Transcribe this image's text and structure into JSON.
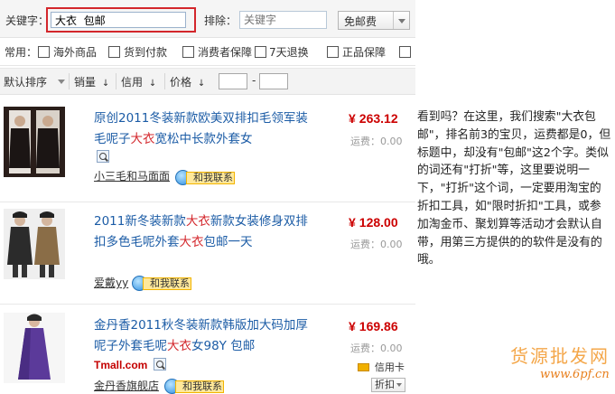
{
  "search": {
    "keyword_label": "关键字：",
    "keyword_value": "大衣  包邮",
    "exclude_label": "排除：",
    "exclude_placeholder": "关键字",
    "shipping_filter": "免邮费"
  },
  "filters": {
    "label": "常用：",
    "options": [
      "海外商品",
      "货到付款",
      "消费者保障",
      "7天退换",
      "正品保障"
    ]
  },
  "sort": {
    "default": "默认排序",
    "sales": "销量",
    "credit": "信用",
    "price": "价格",
    "range_sep": "-"
  },
  "items": [
    {
      "title_parts": [
        "原创2011冬装新款欧美双排扣毛领军装毛呢子",
        "大衣",
        "宽松中长款外套女"
      ],
      "price": "263.12",
      "shipping": "运费：0.00",
      "seller": "小三毛和马面面",
      "contact": "和我联系"
    },
    {
      "title_parts": [
        "2011新冬装新款",
        "大衣",
        "新款女装修身双排扣多色毛呢外套",
        "大衣",
        "包邮一天"
      ],
      "price": "128.00",
      "shipping": "运费：0.00",
      "seller": "爱戴yy",
      "contact": "和我联系"
    },
    {
      "title_parts": [
        "金丹香2011秋冬装新款韩版加大码加厚呢子外套毛呢",
        "大衣",
        "女98Y 包邮"
      ],
      "price": "169.86",
      "shipping": "运费：0.00",
      "seller": "金丹香旗舰店",
      "contact": "和我联系",
      "badge": "Tmall.com",
      "card": "信用卡",
      "discount": "折扣"
    }
  ],
  "currency_symbol": "¥",
  "commentary": "看到吗？在这里，我们搜索\"大衣包邮\"，排名前3的宝贝，运费都是0，但标题中，却没有\"包邮\"这2个字。类似的词还有\"打折\"等，这里要说明一下，\"打折\"这个词，一定要用淘宝的折扣工具，如\"限时折扣\"工具，或参加淘金币、聚划算等活动才会默认自带，用第三方提供的的软件是没有的哦。",
  "watermark": {
    "line1": "货源批发网",
    "line2": "www.6pf.cn"
  }
}
